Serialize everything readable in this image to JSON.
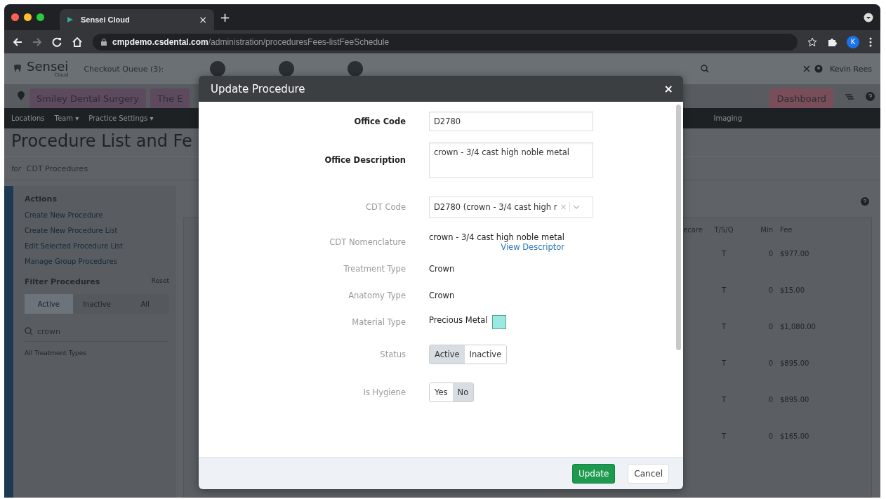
{
  "browser": {
    "tab_title": "Sensei Cloud",
    "tab_close": "×",
    "new_tab": "+",
    "url_host": "cmpdemo.csdental.com",
    "url_path": "/administration/proceduresFees-listFeeSchedule",
    "profile_initial": "K"
  },
  "app_header": {
    "logo": "Sensei",
    "logo_sub": "Cloud",
    "checkout_queue": "Checkout Queue (3):",
    "user": "Kevin Rees"
  },
  "location_tabs": [
    {
      "label": "Smiley Dental Surgery",
      "kind": "location"
    },
    {
      "label": "The E",
      "kind": "location"
    },
    {
      "label": "Dashboard",
      "kind": "dashboard"
    }
  ],
  "nav_left": [
    "Locations",
    "Team ▾",
    "Practice Settings ▾"
  ],
  "nav_right": [
    "Imaging"
  ],
  "page": {
    "title": "Procedure List and Fe",
    "for_label": "for",
    "list_select": "CDT Procedures"
  },
  "sidebar": {
    "actions_heading": "Actions",
    "actions": [
      "Create New Procedure",
      "Create New Procedure List",
      "Edit Selected Procedure List",
      "Manage Group Procedures"
    ],
    "filter_heading": "Filter Procedures",
    "reset": "Reset",
    "status_filter": [
      {
        "label": "Active",
        "selected": true
      },
      {
        "label": "Inactive",
        "selected": false
      },
      {
        "label": "All",
        "selected": false
      }
    ],
    "search": "crown",
    "treatment_types": "All Treatment Types"
  },
  "table": {
    "columns": [
      "ecare",
      "T/S/Q",
      "Min",
      "Fee"
    ],
    "rows": [
      {
        "tsq": "T",
        "min": "0",
        "fee": "$977.00"
      },
      {
        "tsq": "T",
        "min": "0",
        "fee": "$15.00"
      },
      {
        "tsq": "T",
        "min": "0",
        "fee": "$1,080.00"
      },
      {
        "tsq": "T",
        "min": "0",
        "fee": "$895.00"
      },
      {
        "tsq": "T",
        "min": "0",
        "fee": "$895.00"
      },
      {
        "tsq": "T",
        "min": "0",
        "fee": "$165.00"
      }
    ]
  },
  "modal": {
    "title": "Update Procedure",
    "close": "×",
    "fields": [
      {
        "label": "Office Code",
        "required": true,
        "kind": "input",
        "value": "D2780"
      },
      {
        "label": "Office Description",
        "required": true,
        "kind": "textarea",
        "value": "crown - 3/4 cast high noble metal"
      },
      {
        "label": "CDT Code",
        "required": false,
        "kind": "select",
        "value": "D2780 (crown - 3/4 cast high r",
        "clear": "×"
      },
      {
        "label": "CDT Nomenclature",
        "required": false,
        "kind": "text",
        "value": "crown - 3/4 cast high noble metal",
        "link": "View Descriptor"
      },
      {
        "label": "Treatment Type",
        "required": false,
        "kind": "text",
        "value": "Crown"
      },
      {
        "label": "Anatomy Type",
        "required": false,
        "kind": "text",
        "value": "Crown"
      },
      {
        "label": "Material Type",
        "required": false,
        "kind": "color",
        "value": "Precious Metal",
        "color": "#9ee8e4"
      },
      {
        "label": "Status",
        "required": false,
        "kind": "toggle",
        "options": [
          {
            "label": "Active",
            "selected": true
          },
          {
            "label": "Inactive",
            "selected": false
          }
        ]
      },
      {
        "label": "Is Hygiene",
        "required": false,
        "kind": "toggle",
        "options": [
          {
            "label": "Yes",
            "selected": false
          },
          {
            "label": "No",
            "selected": true
          }
        ]
      }
    ],
    "buttons": [
      {
        "label": "Update",
        "kind": "primary"
      },
      {
        "label": "Cancel",
        "kind": "secondary"
      }
    ]
  }
}
